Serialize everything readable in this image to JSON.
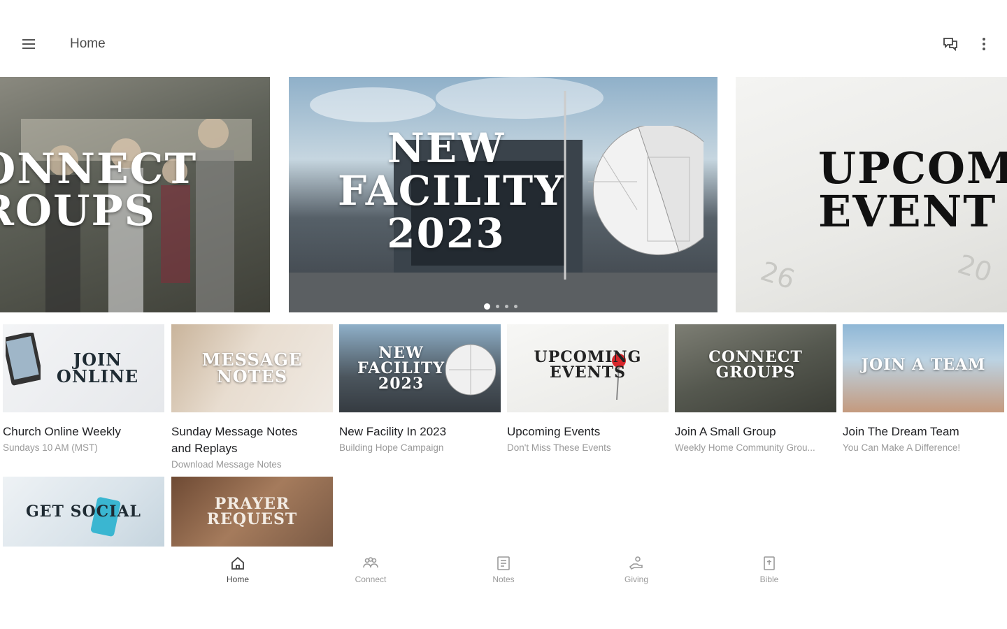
{
  "header": {
    "title": "Home",
    "menu_icon": "hamburger-menu-icon",
    "chat_icon": "chat-bubbles-icon",
    "more_icon": "more-vertical-icon"
  },
  "hero": {
    "slides": [
      {
        "title": "ONNECT\nROUPS"
      },
      {
        "title": "NEW\nFACILITY\n2023"
      },
      {
        "title": "UPCOMI\nEVENT"
      }
    ],
    "calendar_numbers": [
      "26",
      "20"
    ],
    "active_dot": 0,
    "dot_count": 4
  },
  "cards": [
    {
      "thumb_text": "JOIN\nONLINE",
      "title": "Church Online Weekly",
      "subtitle": "Sundays 10 AM (MST)"
    },
    {
      "thumb_text": "MESSAGE\nNOTES",
      "title": "Sunday Message Notes\nand Replays",
      "subtitle": "Download Message Notes"
    },
    {
      "thumb_text": "NEW\nFACILITY\n2023",
      "title": "New Facility In 2023",
      "subtitle": "Building Hope Campaign"
    },
    {
      "thumb_text": "UPCOMING\nEVENTS",
      "title": "Upcoming Events",
      "subtitle": "Don't Miss These Events"
    },
    {
      "thumb_text": "CONNECT\nGROUPS",
      "title": "Join A Small Group",
      "subtitle": "Weekly Home Community Grou..."
    },
    {
      "thumb_text": "JOIN A TEAM",
      "title": "Join The Dream Team",
      "subtitle": "You Can Make A Difference!"
    },
    {
      "thumb_text": "GET SOCIAL",
      "title": "",
      "subtitle": ""
    },
    {
      "thumb_text": "PRAYER\nREQUEST",
      "title": "",
      "subtitle": ""
    }
  ],
  "bottom_nav": [
    {
      "label": "Home",
      "icon": "home-icon"
    },
    {
      "label": "Connect",
      "icon": "people-icon"
    },
    {
      "label": "Notes",
      "icon": "notes-icon"
    },
    {
      "label": "Giving",
      "icon": "giving-hand-icon"
    },
    {
      "label": "Bible",
      "icon": "bible-icon"
    }
  ],
  "colors": {
    "text_primary": "#202124",
    "text_secondary": "#9a9a9a",
    "nav_active": "#444444"
  }
}
